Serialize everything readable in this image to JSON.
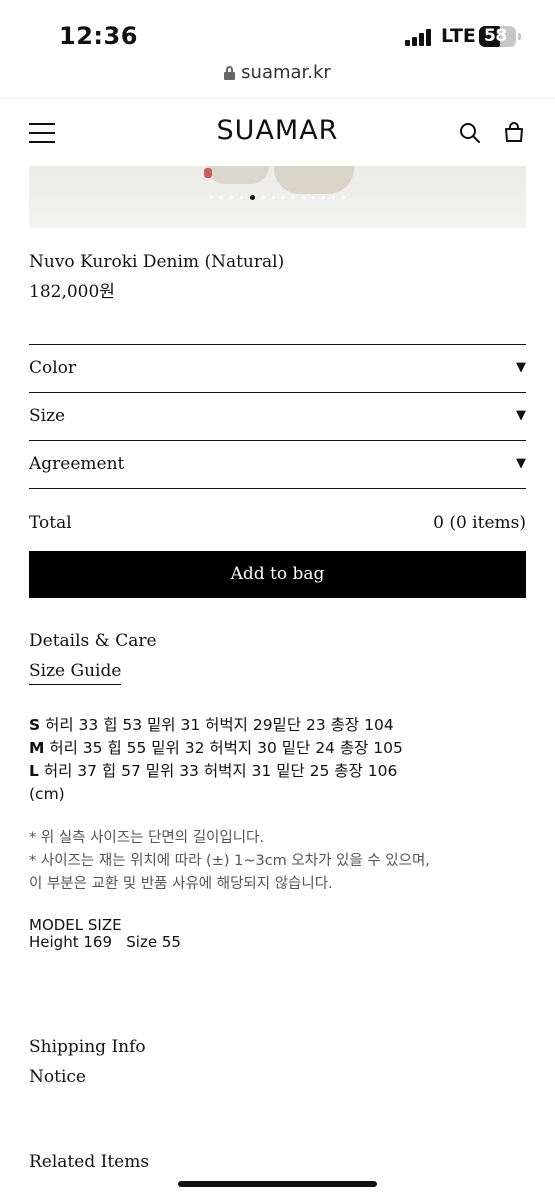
{
  "status_bar": {
    "time": "12:36",
    "network": "LTE",
    "battery_percent": "58",
    "battery_level": 0.58
  },
  "browser": {
    "url": "suamar.kr"
  },
  "header": {
    "logo": "SUAMAR",
    "icons": [
      "menu-icon",
      "search-icon",
      "bag-icon"
    ]
  },
  "carousel": {
    "total_slides": 14,
    "active_index": 4
  },
  "product": {
    "name": "Nuvo Kuroki Denim (Natural)",
    "price": "182,000원"
  },
  "options": [
    {
      "label": "Color",
      "arrow": "▼"
    },
    {
      "label": "Size",
      "arrow": "▼"
    },
    {
      "label": "Agreement",
      "arrow": "▼"
    }
  ],
  "total": {
    "label": "Total",
    "value": "0 (0 items)"
  },
  "add_to_bag": "Add to bag",
  "tabs": {
    "details": "Details & Care",
    "size_guide": "Size Guide"
  },
  "size_guide": {
    "rows": [
      {
        "size": "S",
        "text": " 허리 33 힙 53 밑위 31 허벅지 29밑단 23 총장 104"
      },
      {
        "size": "M",
        "text": " 허리 35 힙 55 밑위 32 허벅지 30 밑단 24 총장 105"
      },
      {
        "size": "L",
        "text": " 허리 37 힙 57 밑위 33 허벅지 31 밑단 25 총장 106"
      }
    ],
    "unit": "(cm)",
    "notes": [
      "* 위 실측 사이즈는 단면의 길이입니다.",
      "* 사이즈는 재는 위치에 따라 (±) 1~3cm 오차가 있을 수 있으며,",
      "이 부분은 교환 및 반품 사유에 해당되지 않습니다."
    ],
    "model_size_title": "MODEL SIZE",
    "model_size_value": "Height 169   Size 55"
  },
  "footer_links": {
    "shipping": "Shipping Info",
    "notice": "Notice",
    "related": "Related Items"
  }
}
